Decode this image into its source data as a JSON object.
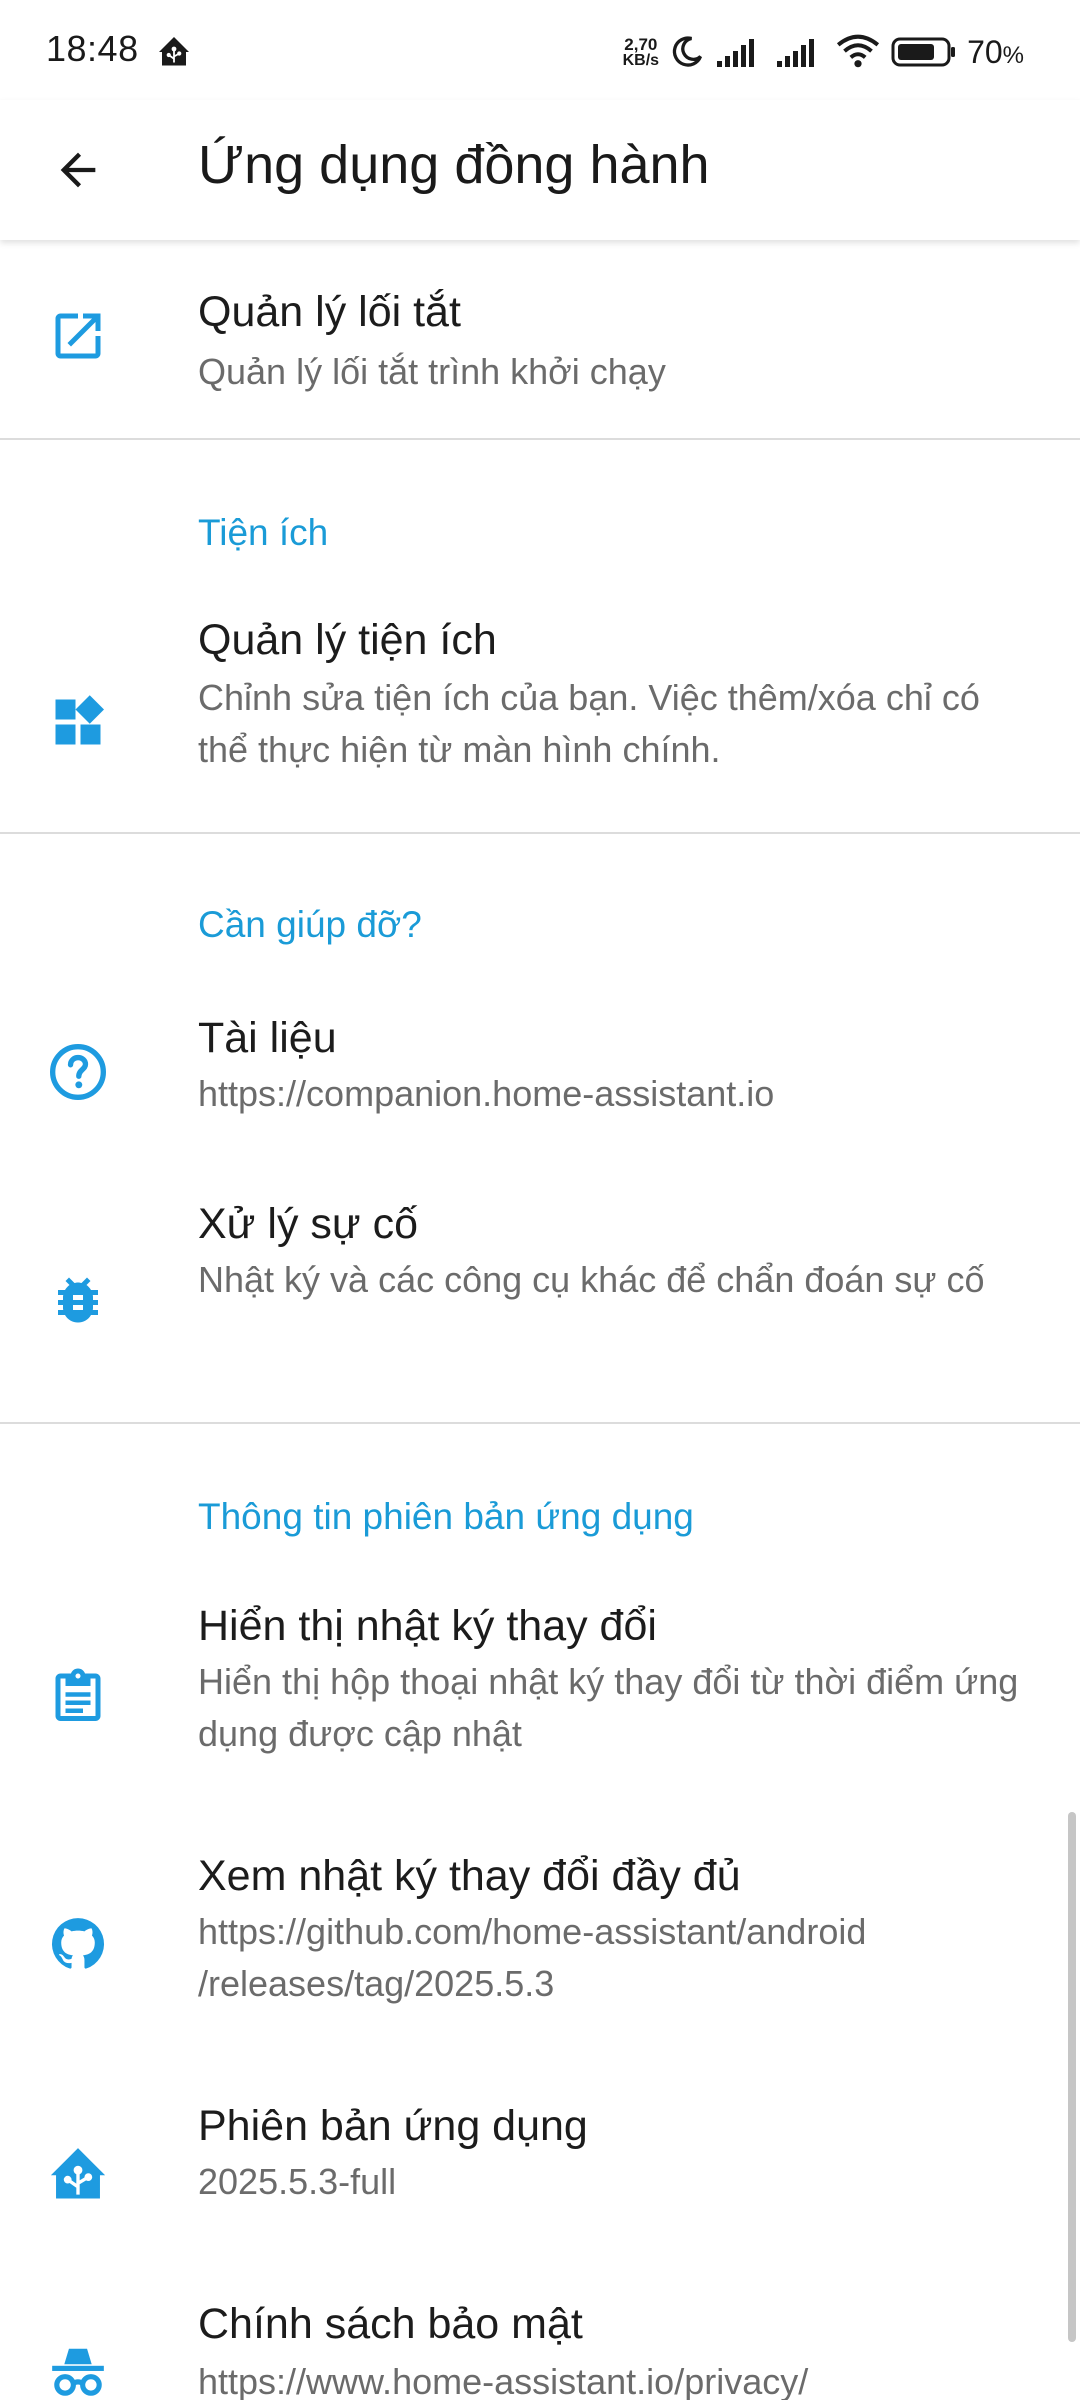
{
  "status_bar": {
    "time": "18:48",
    "net_speed_value": "2,70",
    "net_speed_unit": "KB/s",
    "battery_percent": "70",
    "battery_unit": "%"
  },
  "app_bar": {
    "title": "Ứng dụng đồng hành",
    "back_icon": "arrow-back-icon"
  },
  "colors": {
    "accent": "#1a9bd7",
    "icon": "#1e9be0",
    "primary_text": "#1c1c1c",
    "secondary_text": "#6b6b6b",
    "divider": "#dcdcdc"
  },
  "items": {
    "shortcuts": {
      "icon": "open-in-new-icon",
      "title": "Quản lý lối tắt",
      "subtitle": "Quản lý lối tắt trình khởi chạy"
    },
    "widgets": {
      "icon": "widgets-icon",
      "title": "Quản lý tiện ích",
      "subtitle": "Chỉnh sửa tiện ích của bạn. Việc thêm/xóa chỉ có thể thực hiện từ màn hình chính."
    },
    "documentation": {
      "icon": "help-circle-icon",
      "title": "Tài liệu",
      "subtitle": "https://companion.home-assistant.io"
    },
    "troubleshooting": {
      "icon": "bug-icon",
      "title": "Xử lý sự cố",
      "subtitle": "Nhật ký và các công cụ khác để chẩn đoán sự cố"
    },
    "changelog": {
      "icon": "clipboard-text-icon",
      "title": "Hiển thị nhật ký thay đổi",
      "subtitle": "Hiển thị hộp thoại nhật ký thay đổi từ thời điểm ứng dụng được cập nhật"
    },
    "full_changelog": {
      "icon": "github-icon",
      "title": "Xem nhật ký thay đổi đầy đủ",
      "subtitle": "https://github.com/home-assistant/android /releases/tag/2025.5.3"
    },
    "app_version": {
      "icon": "home-assistant-icon",
      "title": "Phiên bản ứng dụng",
      "subtitle": "2025.5.3-full"
    },
    "privacy": {
      "icon": "incognito-icon",
      "title": "Chính sách bảo mật",
      "subtitle": "https://www.home-assistant.io/privacy/"
    }
  },
  "sections": {
    "widgets_header": "Tiện ích",
    "help_header": "Cần giúp đỡ?",
    "version_header": "Thông tin phiên bản ứng dụng"
  }
}
